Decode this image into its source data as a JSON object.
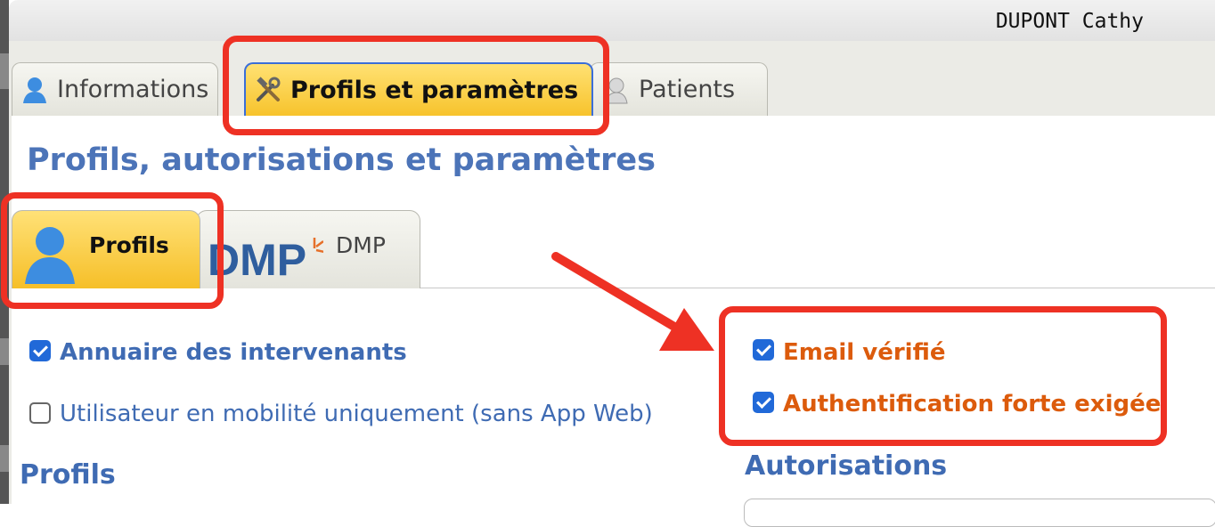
{
  "header": {
    "user_name": "DUPONT Cathy"
  },
  "tabs": [
    {
      "label": "Informations",
      "icon": "user-icon"
    },
    {
      "label": "Profils et paramètres",
      "icon": "tools-icon"
    },
    {
      "label": "Patients",
      "icon": "patients-icon"
    }
  ],
  "section_title": "Profils, autorisations et paramètres",
  "subtabs": [
    {
      "label": "Profils",
      "icon": "user-icon"
    },
    {
      "label": "DMP",
      "logo_text": "DMP"
    }
  ],
  "checkboxes": [
    {
      "label": "Annuaire des intervenants",
      "checked": true
    },
    {
      "label": "Utilisateur en mobilité uniquement (sans App Web)",
      "checked": false
    },
    {
      "label": "Email vérifié",
      "checked": true
    },
    {
      "label": "Authentification forte exigée",
      "checked": true
    }
  ],
  "headings": {
    "profils": "Profils",
    "autorisations": "Autorisations"
  },
  "colors": {
    "accent_blue": "#3f6bb3",
    "active_tab_yellow": "#f7c32c",
    "highlight_red": "#ee3124",
    "warning_orange": "#dc5b0c",
    "checkbox_blue": "#2169d8"
  }
}
